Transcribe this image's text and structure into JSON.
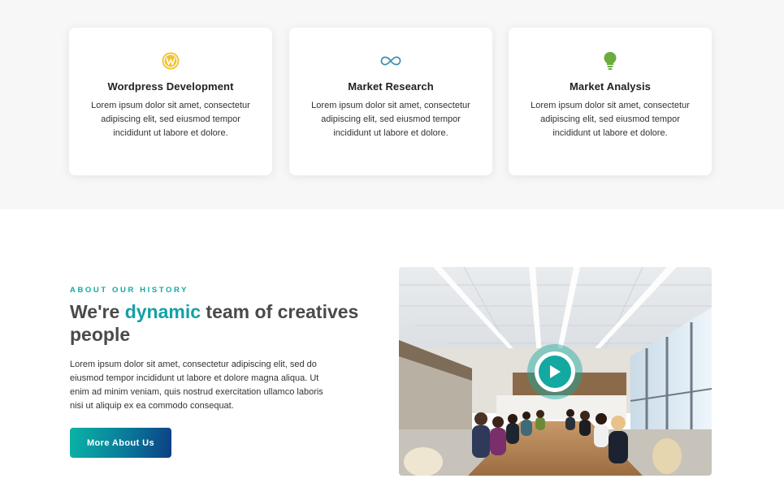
{
  "services": [
    {
      "icon": "wordpress-icon",
      "title": "Wordpress Development",
      "desc_lines": [
        "Lorem ipsum dolor sit amet, consectetur",
        "adipiscing elit, sed eiusmod tempor",
        "incididunt ut labore et dolore."
      ]
    },
    {
      "icon": "infinity-cloud-icon",
      "title": "Market Research",
      "desc_lines": [
        "Lorem ipsum dolor sit amet, consectetur",
        "adipiscing elit, sed eiusmod tempor",
        "incididunt ut labore et dolore."
      ]
    },
    {
      "icon": "lightbulb-icon",
      "title": "Market Analysis",
      "desc_lines": [
        "Lorem ipsum dolor sit amet, consectetur",
        "adipiscing elit, sed eiusmod tempor",
        "incididunt ut labore et dolore."
      ]
    }
  ],
  "about": {
    "label": "ABOUT OUR HISTORY",
    "title_before": "We're ",
    "title_accent": "dynamic",
    "title_after": " team of creatives people",
    "text_lines": [
      "Lorem ipsum dolor sit amet, consectetur adipiscing elit, sed do",
      "eiusmod tempor incididunt ut labore et dolore magna aliqua. Ut",
      "enim ad minim veniam, quis nostrud exercitation ullamco laboris",
      "nisi ut aliquip ex ea commodo consequat."
    ],
    "button_label": "More About Us"
  },
  "video": {
    "play_icon": "play-icon"
  },
  "colors": {
    "accent": "#13a8a0",
    "band_bg": "#f7f7f7",
    "button_gradient_start": "#0ab4a6",
    "button_gradient_end": "#0c3f84"
  }
}
